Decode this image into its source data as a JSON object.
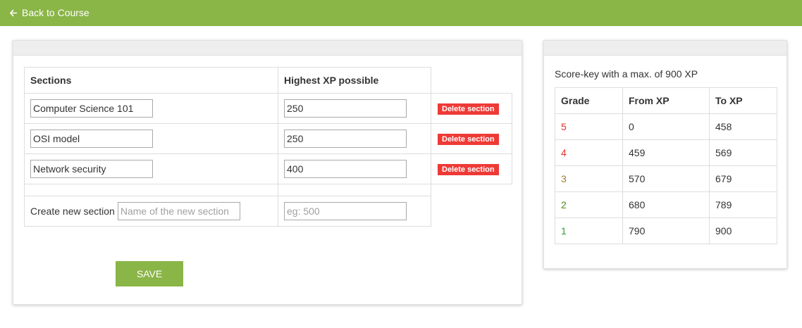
{
  "nav": {
    "back_label": "Back to Course"
  },
  "sections": {
    "headers": [
      "Sections",
      "Highest XP possible"
    ],
    "rows": [
      {
        "name": "Computer Science 101",
        "xp": "250",
        "delete_label": "Delete section"
      },
      {
        "name": "OSI model",
        "xp": "250",
        "delete_label": "Delete section"
      },
      {
        "name": "Network security",
        "xp": "400",
        "delete_label": "Delete section"
      }
    ],
    "create": {
      "label": "Create new section",
      "name_placeholder": "Name of the new section",
      "xp_placeholder": "eg: 500"
    },
    "save_label": "SAVE"
  },
  "score_key": {
    "caption": "Score-key with a max. of 900 XP",
    "headers": [
      "Grade",
      "From XP",
      "To XP"
    ],
    "rows": [
      {
        "grade": "5",
        "from": "0",
        "to": "458",
        "grade_color": "#e8302a"
      },
      {
        "grade": "4",
        "from": "459",
        "to": "569",
        "grade_color": "#e8302a"
      },
      {
        "grade": "3",
        "from": "570",
        "to": "679",
        "grade_color": "#9a8033"
      },
      {
        "grade": "2",
        "from": "680",
        "to": "789",
        "grade_color": "#4f8a1c"
      },
      {
        "grade": "1",
        "from": "790",
        "to": "900",
        "grade_color": "#2f9e2f"
      }
    ]
  },
  "colors": {
    "accent": "#8ab547",
    "danger": "#ee3a36"
  }
}
